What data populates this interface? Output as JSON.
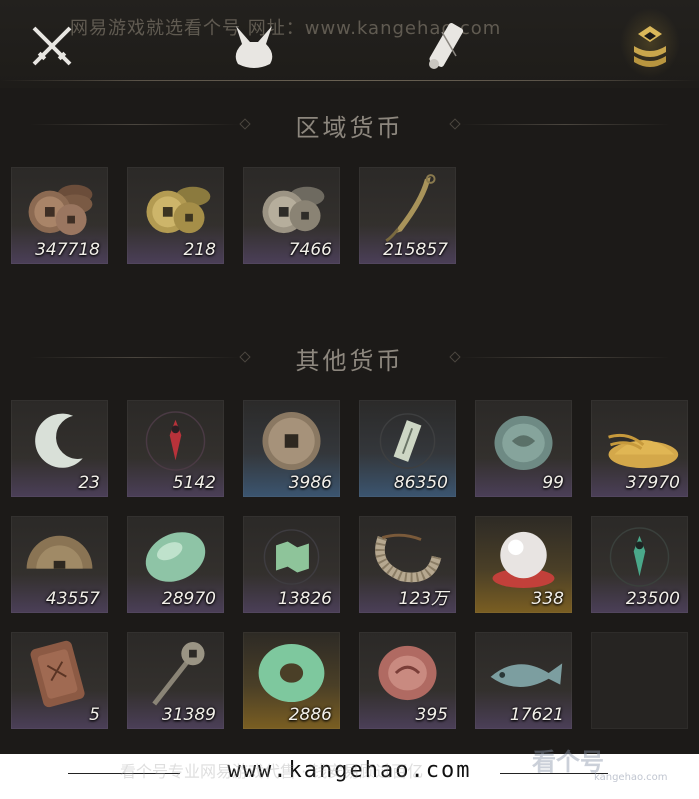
{
  "watermark_top": "网易游戏就选看个号  网址：www.kangehao.com",
  "tabs": [
    {
      "icon": "crossed-swords-icon"
    },
    {
      "icon": "bundle-icon"
    },
    {
      "icon": "scroll-icon"
    },
    {
      "icon": "coin-stack-icon",
      "active": true
    }
  ],
  "sections": {
    "regional": {
      "title": "区域货币",
      "items": [
        {
          "icon": "copper-coin-stack-icon",
          "qty": "347718"
        },
        {
          "icon": "gold-coin-stack-icon",
          "qty": "218"
        },
        {
          "icon": "silver-coin-stack-icon",
          "qty": "7466"
        },
        {
          "icon": "throwing-knife-icon",
          "qty": "215857"
        }
      ]
    },
    "other": {
      "title": "其他货币",
      "items": [
        {
          "icon": "jade-crescent-icon",
          "qty": "23",
          "rarity": "purple"
        },
        {
          "icon": "red-sigil-icon",
          "qty": "5142",
          "rarity": "purple"
        },
        {
          "icon": "ancient-coin-icon",
          "qty": "3986",
          "rarity": "blue"
        },
        {
          "icon": "jade-tablet-icon",
          "qty": "86350",
          "rarity": "blue"
        },
        {
          "icon": "jade-disc-icon",
          "qty": "99",
          "rarity": "purple"
        },
        {
          "icon": "grain-pile-icon",
          "qty": "37970",
          "rarity": "purple"
        },
        {
          "icon": "half-coin-icon",
          "qty": "43557",
          "rarity": "purple"
        },
        {
          "icon": "jade-stone-icon",
          "qty": "28970",
          "rarity": "purple"
        },
        {
          "icon": "map-fragment-icon",
          "qty": "13826",
          "rarity": "purple"
        },
        {
          "icon": "coin-string-icon",
          "qty": "123万",
          "rarity": "purple"
        },
        {
          "icon": "pearl-icon",
          "qty": "338",
          "rarity": "gold"
        },
        {
          "icon": "green-sigil-icon",
          "qty": "23500",
          "rarity": "purple"
        },
        {
          "icon": "bronze-plaque-icon",
          "qty": "5",
          "rarity": "purple"
        },
        {
          "icon": "coin-sword-icon",
          "qty": "31389",
          "rarity": "purple"
        },
        {
          "icon": "jade-ring-icon",
          "qty": "2886",
          "rarity": "gold"
        },
        {
          "icon": "red-jade-icon",
          "qty": "395",
          "rarity": "purple"
        },
        {
          "icon": "jade-fish-icon",
          "qty": "17621",
          "rarity": "purple"
        },
        {
          "icon": "",
          "qty": "",
          "rarity": "empty"
        }
      ]
    }
  },
  "footer": {
    "url": "www.kangehao.com",
    "band_text": "看个号专业网易游戏代售 · 钱安易顾过百亿",
    "logo_text": "看个号",
    "logo_sub": "kangehao.com"
  }
}
